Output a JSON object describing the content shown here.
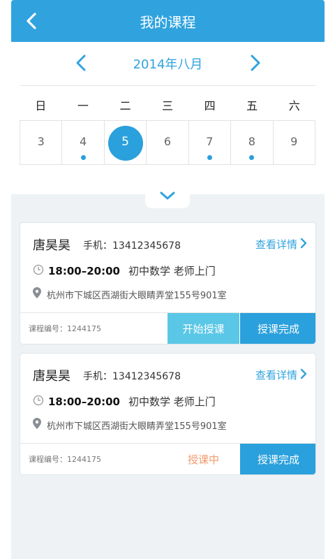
{
  "header": {
    "title": "我的课程",
    "back_icon": "back-chevron-icon"
  },
  "calendar": {
    "month": "2014年八月",
    "prev_icon": "chevron-left-icon",
    "next_icon": "chevron-right-icon",
    "weekdays": [
      "日",
      "一",
      "二",
      "三",
      "四",
      "五",
      "六"
    ],
    "days": [
      {
        "num": "3",
        "dot": false,
        "selected": false
      },
      {
        "num": "4",
        "dot": true,
        "selected": false
      },
      {
        "num": "5",
        "dot": false,
        "selected": true
      },
      {
        "num": "6",
        "dot": false,
        "selected": false
      },
      {
        "num": "7",
        "dot": true,
        "selected": false
      },
      {
        "num": "8",
        "dot": true,
        "selected": false
      },
      {
        "num": "9",
        "dot": false,
        "selected": false
      }
    ],
    "accent": "#2aa0dc"
  },
  "courses": [
    {
      "name": "唐昊昊",
      "phone": "手机：13412345678",
      "detail_label": "查看详情",
      "time": "18:00–20:00",
      "course": "初中数学  老师上门",
      "address": "杭州市下城区西湖街大眼睛弄堂155号901室",
      "course_no": "课程编号：1244175",
      "start_label": "开始授课",
      "done_label": "授课完成"
    },
    {
      "name": "唐昊昊",
      "phone": "手机：13412345678",
      "detail_label": "查看详情",
      "time": "18:00–20:00",
      "course": "初中数学  老师上门",
      "address": "杭州市下城区西湖街大眼睛弄堂155号901室",
      "course_no": "课程编号：1244175",
      "status_label": "授课中",
      "done_label": "授课完成"
    }
  ],
  "colors": {
    "header": "#30a3df",
    "button_start": "#5ac7e6",
    "button_done": "#2aa0dc",
    "status": "#f39a6b"
  }
}
